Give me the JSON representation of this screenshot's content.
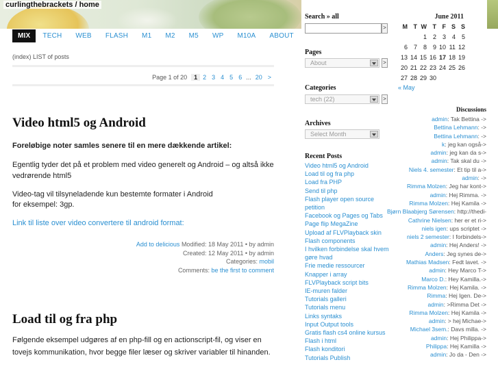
{
  "header": {
    "site_title": "curlingthebrackets / home"
  },
  "nav": [
    {
      "label": "MIX",
      "active": true
    },
    {
      "label": "TECH"
    },
    {
      "label": "WEB"
    },
    {
      "label": "FLASH"
    },
    {
      "label": "M1"
    },
    {
      "label": "M2"
    },
    {
      "label": "M5"
    },
    {
      "label": "WP"
    },
    {
      "label": "M10A"
    },
    {
      "label": "ABOUT"
    }
  ],
  "index_label": "(index) LIST of posts",
  "pager": {
    "label": "Page 1 of 20",
    "current": "1",
    "pages": [
      "2",
      "3",
      "4",
      "5",
      "6"
    ],
    "ellipsis": "...",
    "last": "20",
    "next": ">"
  },
  "post1": {
    "title": "Video html5 og Android",
    "lead": "Foreløbige noter samles senere til en mere dækkende artikel:",
    "p1": "Egentlig tyder det på et problem med video generelt og Android – og altså ikke vedrørende html5",
    "p2": "Video-tag vil tilsyneladende kun bestemte formater i Android",
    "p3": "for eksempel: 3gp.",
    "link": "Link til liste over video convertere til android format:",
    "meta_link": "Add to delicious",
    "modified": " Modified: 18 May 2011 • by admin",
    "created": "Created: 12 May 2011 • by admin",
    "categories_label": "Categories: ",
    "category": "mobil",
    "comments_label": "Comments: ",
    "comments_link": "be the first to comment"
  },
  "post2": {
    "title": "Load til og fra php",
    "p1": "Følgende eksempel udgøres af en php-fill og en actionscript-fil, og viser en",
    "p2": "tovejs kommunikation, hvor begge filer læser og skriver variabler til hinanden."
  },
  "sidebar": {
    "search_heading": "Search » all",
    "go": ">",
    "pages_heading": "Pages",
    "pages_value": "About",
    "categories_heading": "Categories",
    "categories_value": "tech  (22)",
    "archives_heading": "Archives",
    "archives_value": "Select Month",
    "recent_heading": "Recent Posts",
    "recent_posts": [
      "Video html5 og Android",
      "Load til og fra php",
      "Load fra PHP",
      "Send til php",
      "Flash player open source",
      "petition",
      "Facebook og Pages og Tabs",
      "Page flip MegaZine",
      "Upload af FLVPlayback skin",
      "Flash components",
      "I hvilken forbindelse skal hvem",
      "gøre hvad",
      "Frie medie ressourcer",
      "Knapper i array",
      "FLVPlayback script bits",
      "IE-muren falder",
      "Tutorials galleri",
      "Tutorials menu",
      "Links syntaks",
      "Input Output tools",
      "Gratis flash cs4 online kursus",
      "Flash i html",
      "Flash konditori",
      "Tutorials Publish"
    ]
  },
  "calendar": {
    "caption": "June 2011",
    "weekdays": [
      "M",
      "T",
      "W",
      "T",
      "F",
      "S",
      "S"
    ],
    "cells": [
      "",
      "",
      "1",
      "2",
      "3",
      "4",
      "5",
      "6",
      "7",
      "8",
      "9",
      "10",
      "11",
      "12",
      "13",
      "14",
      "15",
      "16",
      "17",
      "18",
      "19",
      "20",
      "21",
      "22",
      "23",
      "24",
      "25",
      "26",
      "27",
      "28",
      "29",
      "30",
      "",
      "",
      ""
    ],
    "today": "17",
    "prev": "« May"
  },
  "discussions": {
    "heading": "Discussions",
    "items": [
      {
        "author": "admin",
        "text": ": Tak Bettina ->"
      },
      {
        "author": "Bettina Lehmann",
        "text": ": ->"
      },
      {
        "author": "Bettina Lehmann",
        "text": ": ->"
      },
      {
        "author": "k",
        "text": ": jeg kan også->"
      },
      {
        "author": "admin",
        "text": ": jeg kan da s->"
      },
      {
        "author": "admin",
        "text": ": Tak skal du ->"
      },
      {
        "author": "Niels 4. semester",
        "text": ": Et tip til a->"
      },
      {
        "author": "admin",
        "text": ": ->"
      },
      {
        "author": "Rimma Molzen",
        "text": ": Jeg har kont->"
      },
      {
        "author": "admin",
        "text": ": Hej Rimma. ->"
      },
      {
        "author": "Rimma Molzen",
        "text": ": Hej Kamila ->"
      },
      {
        "author": "Bjørn Blaabjerg Sørensen",
        "text": ": http://thedi->"
      },
      {
        "author": "Cathrine Nielsen",
        "text": ": her er et ri->"
      },
      {
        "author": "niels igen",
        "text": ": ups scriptet ->"
      },
      {
        "author": "niels 2 semester",
        "text": ": I forbindels->"
      },
      {
        "author": "admin",
        "text": ": Hej Anders! ->"
      },
      {
        "author": "Anders",
        "text": ": Jeg synes de->"
      },
      {
        "author": "Mathias Madsen",
        "text": ": Fedt lavet. ->"
      },
      {
        "author": "admin",
        "text": ": Hey Marco T->"
      },
      {
        "author": "Marco D.",
        "text": ": Hey Kamilla.->"
      },
      {
        "author": "Rimma Molzen",
        "text": ": Hej Kamila. ->"
      },
      {
        "author": "Rimma",
        "text": ": Hej Igen. De->"
      },
      {
        "author": "admin",
        "text": ": >Rimma Det ->"
      },
      {
        "author": "Rimma Molzen",
        "text": ": Hej Kamila ->"
      },
      {
        "author": "admin",
        "text": ": > hej Michae->"
      },
      {
        "author": "Michael 3sem.",
        "text": ": Davs milla. ->"
      },
      {
        "author": "admin",
        "text": ": Hej Philippa->"
      },
      {
        "author": "Philippa",
        "text": ": Hej Kamilla ->"
      },
      {
        "author": "admin",
        "text": ": Jo da - Den ->"
      }
    ]
  }
}
